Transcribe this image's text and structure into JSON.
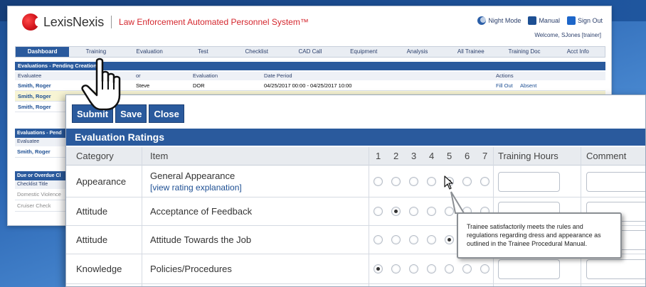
{
  "app": {
    "brand": "LexisNexis",
    "system_name": "Law Enforcement Automated Personnel System™",
    "top_links": {
      "night_mode": "Night Mode",
      "manual": "Manual",
      "sign_out": "Sign Out"
    },
    "welcome": "Welcome, SJones [trainer]"
  },
  "nav": {
    "tabs": [
      "Dashboard",
      "Training",
      "Evaluation",
      "Test",
      "Checklist",
      "CAD Call",
      "Equipment",
      "Analysis",
      "All Trainee",
      "Training Doc",
      "Acct Info"
    ],
    "active": "Dashboard"
  },
  "pending_creation": {
    "title": "Evaluations - Pending Creation",
    "headers": {
      "evaluatee": "Evaluatee",
      "evaluator": "or",
      "evaluation": "Evaluation",
      "date_period": "Date Period",
      "actions": "Actions"
    },
    "rows": [
      {
        "evaluatee": "Smith, Roger",
        "evaluator": "Steve",
        "evaluation": "DOR",
        "date_period": "04/25/2017 00:00 - 04/25/2017 10:00",
        "action_fill": "Fill Out",
        "action_absent": "Absent"
      },
      {
        "evaluatee": "Smith, Roger"
      },
      {
        "evaluatee": "Smith, Roger"
      }
    ]
  },
  "pending_panel": {
    "title": "Evaluations - Pend",
    "header": "Evaluatee",
    "rows": [
      "Smith, Roger"
    ]
  },
  "due_panel": {
    "title": "Due or Overdue Cl",
    "header": "Checklist Title",
    "rows": [
      "Domestic Violence",
      "Cruiser Check"
    ]
  },
  "dialog": {
    "buttons": {
      "submit": "Submit",
      "save": "Save",
      "close": "Close"
    },
    "section_title": "Evaluation Ratings",
    "headers": {
      "category": "Category",
      "item": "Item",
      "ratings": [
        "1",
        "2",
        "3",
        "4",
        "5",
        "6",
        "7"
      ],
      "training_hours": "Training Hours",
      "comment": "Comment"
    },
    "rows": [
      {
        "category": "Appearance",
        "item": "General Appearance",
        "link": "[view rating explanation]",
        "selected": 5
      },
      {
        "category": "Attitude",
        "item": "Acceptance of Feedback",
        "selected": 2
      },
      {
        "category": "Attitude",
        "item": "Attitude Towards the Job",
        "selected": 5
      },
      {
        "category": "Knowledge",
        "item": "Policies/Procedures",
        "selected": 1
      }
    ],
    "tooltip": "Trainee satisfactorily meets the rules and regulations regarding dress and appearance as outlined in the Trainee Procedural Manual."
  },
  "colors": {
    "primary": "#2a5a9d",
    "brand_red": "#d3151c",
    "link": "#1d4f93",
    "highlight_row": "#f7f4d4"
  }
}
